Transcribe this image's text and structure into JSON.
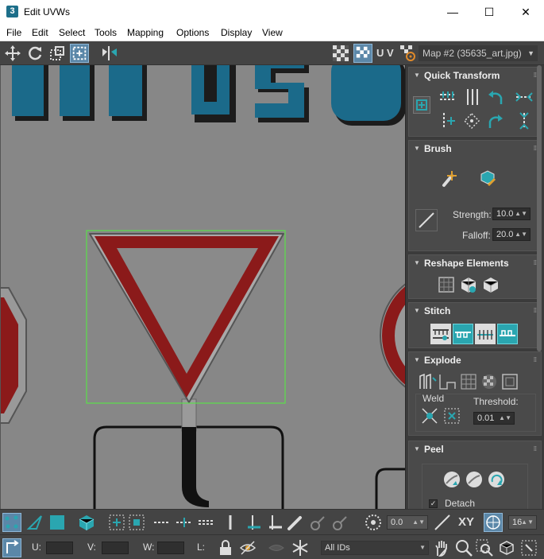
{
  "window": {
    "app_icon_text": "3",
    "title": "Edit UVWs",
    "minimize": "—",
    "maximize": "☐",
    "close": "✕"
  },
  "menu": [
    "File",
    "Edit",
    "Select",
    "Tools",
    "Mapping",
    "Options",
    "Display",
    "View"
  ],
  "toolbar": {
    "uv_label": "U V",
    "map_select": "Map #2 (35635_art.jpg)"
  },
  "panel": {
    "quick_transform": "Quick Transform",
    "brush": "Brush",
    "strength_label": "Strength:",
    "strength_value": "10.0",
    "falloff_label": "Falloff:",
    "falloff_value": "20.0",
    "reshape": "Reshape Elements",
    "stitch": "Stitch",
    "explode": "Explode",
    "weld_label": "Weld",
    "threshold_label": "Threshold:",
    "threshold_value": "0.01",
    "peel": "Peel",
    "detach_label": "Detach",
    "detach_checked": true
  },
  "bottom": {
    "angle_value": "0.0",
    "xy_label": "XY",
    "snap_value": "16",
    "u_label": "U:",
    "v_label": "V:",
    "w_label": "W:",
    "l_label": "L:",
    "ids_select": "All IDs"
  },
  "colors": {
    "accent": "#2aa6b0",
    "active": "#5b87a8",
    "selection": "#59e04a",
    "sign_red": "#8b1a1a",
    "sign_text": "#1b6a8a"
  }
}
